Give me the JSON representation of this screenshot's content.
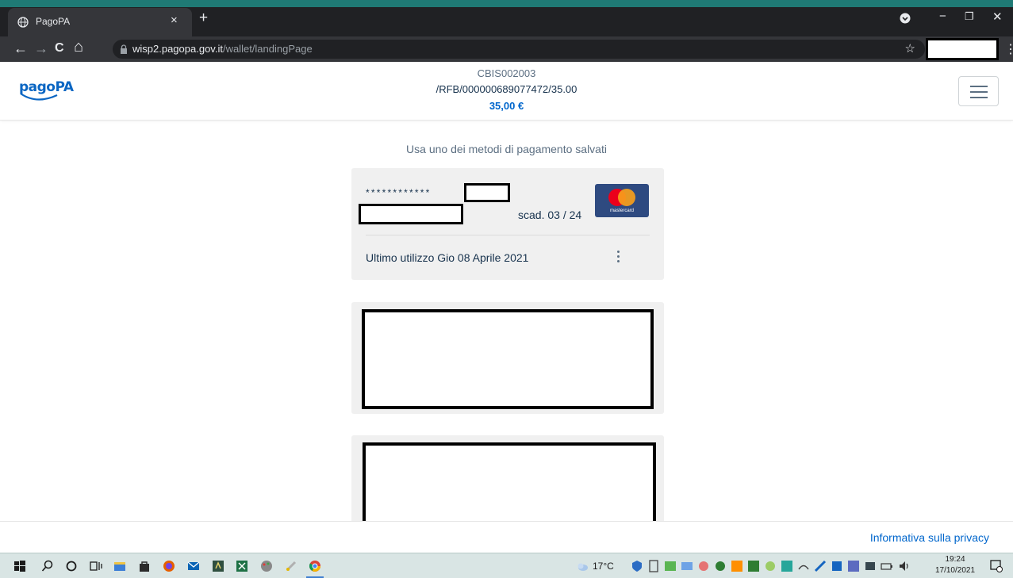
{
  "browser": {
    "tab_title": "PagoPA",
    "tab_close": "×",
    "new_tab": "+",
    "url_host": "wisp2.pagopa.gov.it",
    "url_path": "/wallet/landingPage",
    "star": "☆",
    "menu": "⋮",
    "minimize": "−",
    "restore": "❐",
    "close": "✕",
    "back": "←",
    "forward": "→",
    "reload": "C",
    "home": "⌂"
  },
  "header": {
    "logo_text": "pagoPA",
    "creditor_code": "CBIS002003",
    "reference": "/RFB/000000689077472/35.00",
    "amount": "35,00 €"
  },
  "main": {
    "subtitle": "Usa uno dei metodi di pagamento salvati",
    "saved_card": {
      "masked_pan": "************",
      "expiry": "scad. 03 / 24",
      "brand": "mastercard",
      "last_use": "Ultimo utilizzo Gio 08 Aprile 2021"
    }
  },
  "footer": {
    "privacy_link": "Informativa sulla privacy"
  },
  "taskbar": {
    "temperature": "17°C",
    "time": "19:24",
    "date": "17/10/2021"
  },
  "colors": {
    "brand_blue": "#0066cc",
    "text_dark": "#17324d",
    "text_muted": "#5c6f82",
    "card_bg": "#f0f0f0"
  },
  "icons": [
    "globe-icon",
    "lock-icon",
    "star-icon",
    "hamburger-icon",
    "kebab-icon",
    "mastercard-logo",
    "windows-start-icon",
    "search-icon"
  ]
}
